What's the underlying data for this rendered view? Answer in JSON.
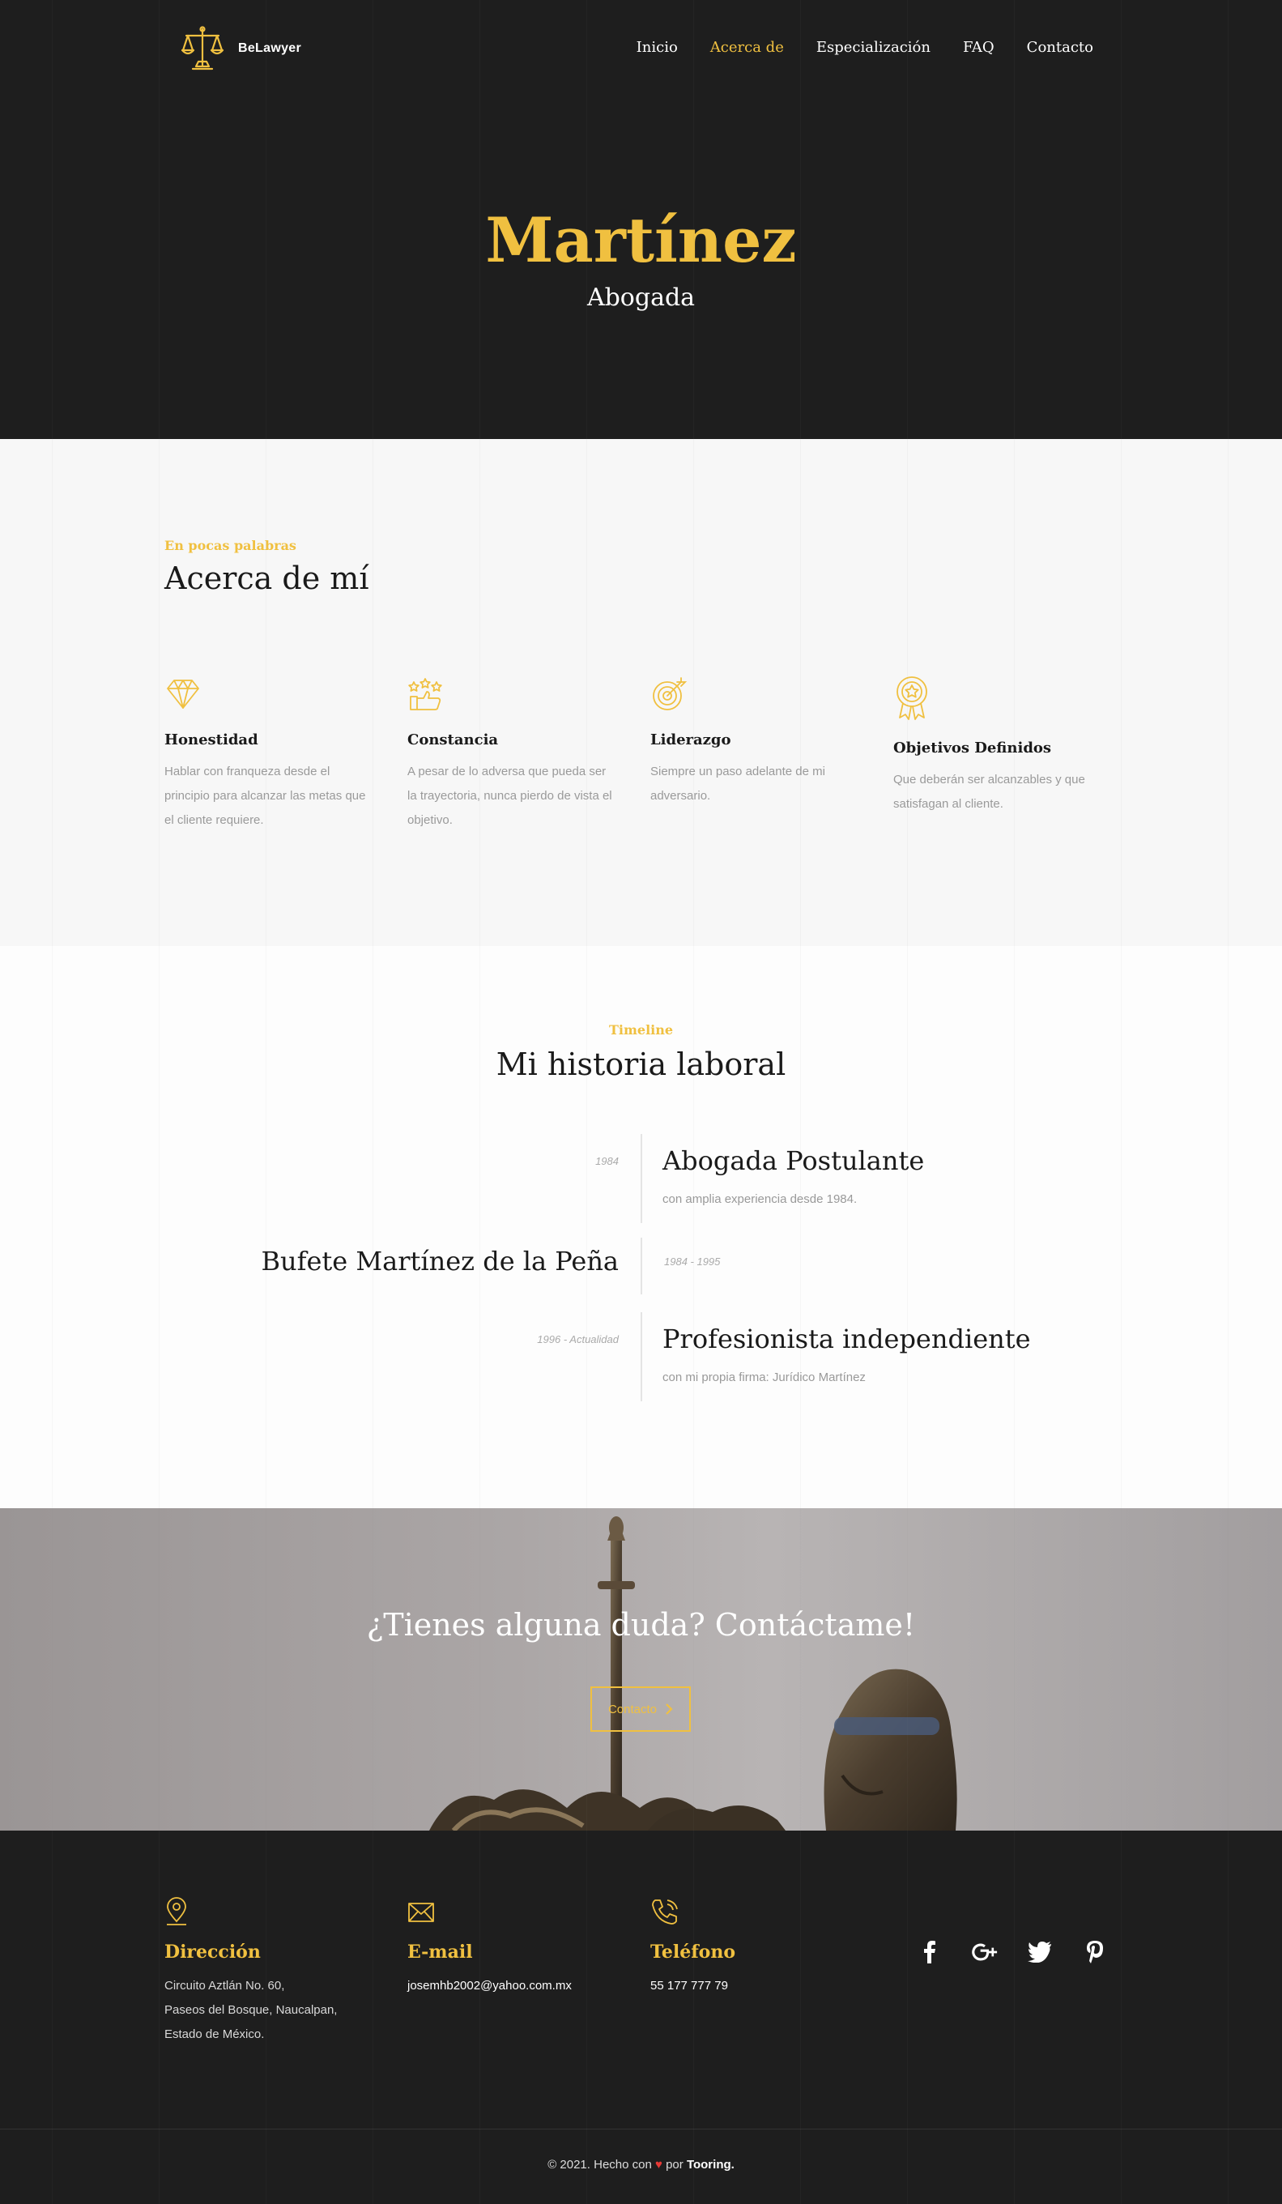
{
  "brand": {
    "name": "BeLawyer",
    "logo_icon": "scales-of-justice-icon"
  },
  "nav": {
    "items": [
      {
        "label": "Inicio",
        "active": false
      },
      {
        "label": "Acerca de",
        "active": true
      },
      {
        "label": "Especialización",
        "active": false
      },
      {
        "label": "FAQ",
        "active": false
      },
      {
        "label": "Contacto",
        "active": false
      }
    ]
  },
  "hero": {
    "title": "Martínez",
    "subtitle": "Abogada"
  },
  "about": {
    "eyebrow": "En pocas palabras",
    "heading": "Acerca de mí",
    "features": [
      {
        "icon": "diamond-icon",
        "title": "Honestidad",
        "text": "Hablar con franqueza desde el principio para alcanzar las metas que el cliente requiere."
      },
      {
        "icon": "thumbs-up-stars-icon",
        "title": "Constancia",
        "text": "A pesar de lo adversa que pueda ser la trayectoria, nunca pierdo de vista el objetivo."
      },
      {
        "icon": "target-icon",
        "title": "Liderazgo",
        "text": "Siempre un paso adelante de mi adversario."
      },
      {
        "icon": "award-medal-icon",
        "title": "Objetivos Definidos",
        "text": "Que deberán ser alcanzables y que satisfagan al cliente."
      }
    ]
  },
  "timeline": {
    "eyebrow": "Timeline",
    "heading": "Mi historia laboral",
    "entries": [
      {
        "date": "1984",
        "title": "Abogada Postulante",
        "desc": "con amplia experiencia desde 1984."
      },
      {
        "date": "1984 - 1995",
        "title": "Bufete Martínez de la Peña",
        "desc": ""
      },
      {
        "date": "1996 - Actualidad",
        "title": "Profesionista independiente",
        "desc": "con mi propia firma: Jurídico Martínez"
      }
    ]
  },
  "cta": {
    "heading": "¿Tienes alguna duda? Contáctame!",
    "button_label": "Contacto",
    "button_icon": "chevron-right-icon"
  },
  "footer": {
    "address": {
      "icon": "map-pin-icon",
      "title": "Dirección",
      "lines": [
        "Circuito Aztlán No. 60,",
        "Paseos del Bosque, Naucalpan,",
        "Estado de México."
      ]
    },
    "email": {
      "icon": "envelope-icon",
      "title": "E-mail",
      "value": "josemhb2002@yahoo.com.mx"
    },
    "phone": {
      "icon": "phone-icon",
      "title": "Teléfono",
      "value": "55 177 777 79"
    },
    "social": [
      "facebook-icon",
      "google-plus-icon",
      "twitter-icon",
      "pinterest-icon"
    ],
    "copyright": {
      "prefix": "© 2021. Hecho con",
      "heart": "♥",
      "middle": "por",
      "author": "Tooring."
    }
  },
  "colors": {
    "accent": "#f0c040",
    "dark": "#1e1e1e",
    "light": "#f7f7f7"
  }
}
